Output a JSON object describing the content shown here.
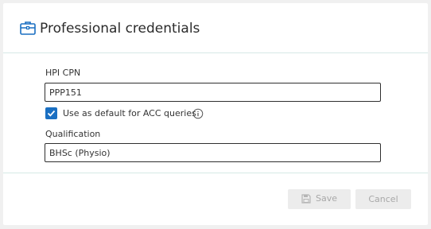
{
  "header": {
    "title": "Professional credentials",
    "icon": "briefcase-icon"
  },
  "form": {
    "hpi_cpn": {
      "label": "HPI CPN",
      "value": "PPP151"
    },
    "default_acc": {
      "label": "Use as default for ACC queries",
      "checked": true,
      "info_icon": "info-icon"
    },
    "qualification": {
      "label": "Qualification",
      "value": "BHSc (Physio)"
    }
  },
  "footer": {
    "save_label": "Save",
    "save_icon": "save-icon",
    "cancel_label": "Cancel"
  },
  "colors": {
    "accent": "#1a6fc2",
    "divider": "#d6e9e6",
    "button_bg": "#ececec",
    "button_text": "#a8a8a8"
  }
}
